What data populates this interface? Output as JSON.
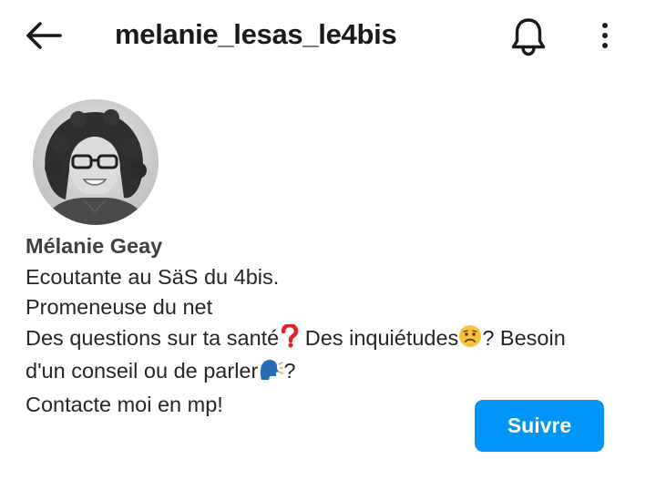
{
  "header": {
    "username": "melanie_lesas_le4bis",
    "back_icon": "arrow-left-icon",
    "notification_icon": "bell-icon",
    "more_icon": "more-vertical-icon"
  },
  "profile": {
    "avatar_alt": "Mélanie Geay",
    "display_name": "Mélanie Geay",
    "bio": {
      "line1": "Ecoutante au SäS du 4bis.",
      "line2": "Promeneuse du net",
      "line3_part1": "Des questions sur ta santé",
      "line3_part2": " Des inquiétudes",
      "line3_part3": "? Besoin",
      "line4_part1": "d'un conseil ou de parler",
      "line4_part2": "?",
      "line5": "Contacte moi en mp!"
    },
    "emojis": [
      "red-question-mark-emoji",
      "worried-face-emoji",
      "speaking-head-emoji"
    ]
  },
  "actions": {
    "follow_label": "Suivre"
  },
  "colors": {
    "accent": "#0095f6",
    "text": "#262626",
    "background": "#ffffff"
  }
}
